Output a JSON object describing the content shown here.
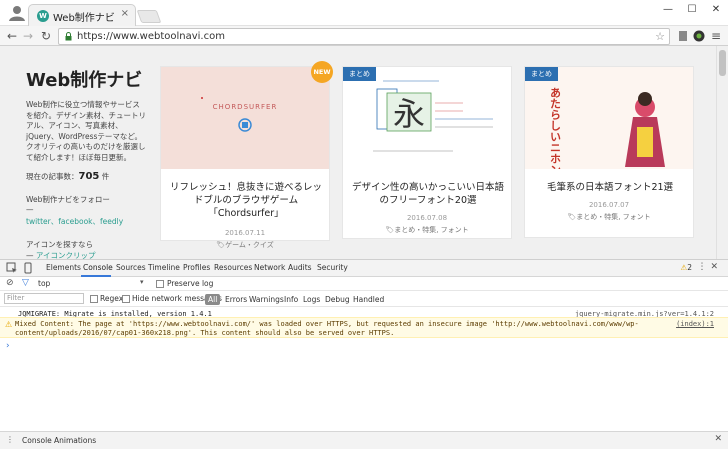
{
  "browser": {
    "tab_title": "Web制作ナビ",
    "tab_favicon": "W",
    "url": "https://www.webtoolnavi.com",
    "tab_close": "×",
    "win_min": "—",
    "win_max": "☐",
    "win_close": "✕"
  },
  "page": {
    "site_title": "Web制作ナビ",
    "site_desc": "Web制作に役立つ情報やサービスを紹介。デザイン素材、チュートリアル、アイコン、写真素材、jQuery、WordPressテーマなど。クオリティの高いものだけを厳選して紹介します！ほぼ毎日更新。",
    "count_label": "現在の記事数：",
    "count_value": "705",
    "count_unit": "件",
    "follow_label": "Web制作ナビをフォロー",
    "follow_dash": "—",
    "social_twitter": "twitter",
    "social_sep1": "、",
    "social_facebook": "facebook",
    "social_sep2": "、",
    "social_feedly": "feedly",
    "icon_find": "アイコンを探すなら",
    "icon_find_link": "アイコンクリップ",
    "cards": [
      {
        "badge": "NEW",
        "title": "リフレッシュ！息抜きに遊べるレッドブルのブラウザゲーム「Chordsurfer」",
        "date": "2016.07.11",
        "tags": "ゲーム・クイズ",
        "thumb_text": "CHORDSURFER"
      },
      {
        "badge": "まとめ",
        "title": "デザイン性の高いかっこいい日本語のフリーフォント20選",
        "date": "2016.07.08",
        "tags": "まとめ・特集, フォント",
        "thumb_text": "永"
      },
      {
        "badge": "まとめ",
        "title": "毛筆系の日本語フォント21選",
        "date": "2016.07.07",
        "tags": "まとめ・特集, フォント",
        "thumb_text": "あたらしいニホンのフォントが"
      }
    ]
  },
  "devtools": {
    "tabs": [
      "Elements",
      "Console",
      "Sources",
      "Timeline",
      "Profiles",
      "Resources",
      "Network",
      "Audits",
      "Security"
    ],
    "active_tab": "Console",
    "warn_count": "2",
    "context": "top",
    "preserve_log": "Preserve log",
    "filter_placeholder": "Filter",
    "regex": "Regex",
    "hide_network": "Hide network messages",
    "levels": [
      "All",
      "Errors",
      "Warnings",
      "Info",
      "Logs",
      "Debug",
      "Handled"
    ],
    "active_level": "All",
    "log1_text": "JQMIGRATE: Migrate is installed, version 1.4.1",
    "log1_src": "jquery-migrate.min.js?ver=1.4.1:2",
    "warn_line1": "Mixed Content: The page at 'https://www.webtoolnavi.com/' was loaded over HTTPS, but requested an insecure image 'http://www.webtoolnavi.com/www/wp-",
    "warn_line2": "content/uploads/2016/07/cap01-360x218.png'. This content should also be served over HTTPS.",
    "warn_src": "(index):1",
    "prompt": "›",
    "drawer_tabs": [
      "Console",
      "Animations"
    ]
  },
  "colors": {
    "accent": "#2a9d8f",
    "badge_blue": "#2c6fb1",
    "badge_new": "#f5a623",
    "devtools_active": "#3879d9"
  }
}
